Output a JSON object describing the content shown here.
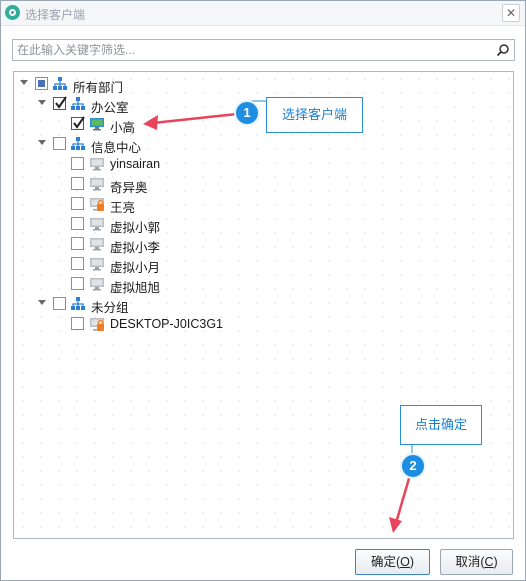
{
  "window": {
    "title": "选择客户端",
    "close_glyph": "✕"
  },
  "search": {
    "placeholder": "在此输入关键字筛选..."
  },
  "tree": {
    "root": {
      "label": "所有部门",
      "state": "partial"
    },
    "groups": [
      {
        "label": "办公室",
        "checked": true,
        "items": [
          {
            "label": "小高",
            "checked": true,
            "locked": false
          }
        ]
      },
      {
        "label": "信息中心",
        "checked": false,
        "items": [
          {
            "label": "yinsairan",
            "locked": false
          },
          {
            "label": "奇异奥",
            "locked": false
          },
          {
            "label": "王亮",
            "locked": true
          },
          {
            "label": "虚拟小郭",
            "locked": false
          },
          {
            "label": "虚拟小李",
            "locked": false
          },
          {
            "label": "虚拟小月",
            "locked": false
          },
          {
            "label": "虚拟旭旭",
            "locked": false
          }
        ]
      },
      {
        "label": "未分组",
        "checked": false,
        "items": [
          {
            "label": "DESKTOP-J0IC3G1",
            "locked": true
          }
        ]
      }
    ]
  },
  "callouts": [
    {
      "number": "1",
      "text": "选择客户端"
    },
    {
      "number": "2",
      "text": "点击确定"
    }
  ],
  "buttons": {
    "ok": {
      "label": "确定(",
      "key": "O",
      "close": ")"
    },
    "cancel": {
      "label": "取消(",
      "key": "C",
      "close": ")"
    }
  },
  "colors": {
    "callout_blue": "#1f8ee0",
    "arrow_red": "#e8445a",
    "tree_icon_blue": "#2d7fd3"
  }
}
